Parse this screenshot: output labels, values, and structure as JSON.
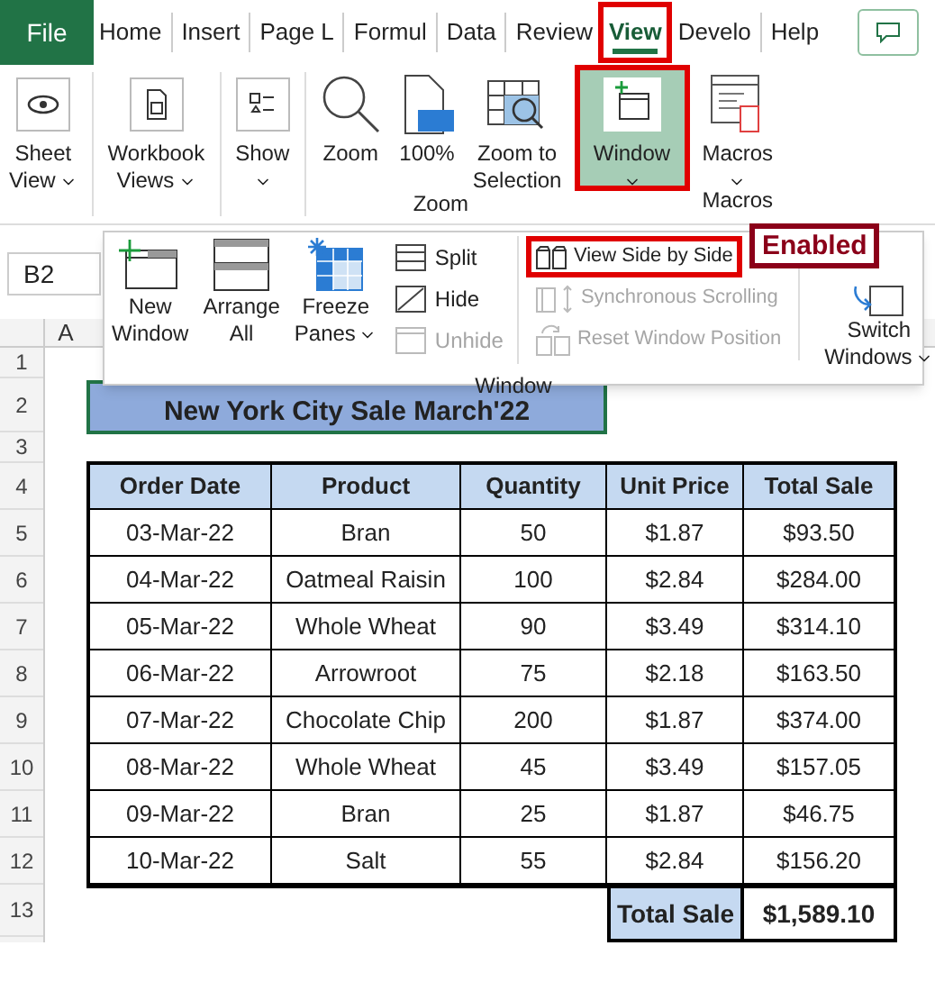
{
  "tabs": [
    {
      "label": "File",
      "kind": "file",
      "selected": false,
      "highlighted": false
    },
    {
      "label": "Home",
      "kind": "tab",
      "selected": false,
      "highlighted": false
    },
    {
      "label": "Insert",
      "kind": "tab",
      "selected": false,
      "highlighted": false
    },
    {
      "label": "Page L",
      "kind": "tab",
      "selected": false,
      "highlighted": false
    },
    {
      "label": "Formul",
      "kind": "tab",
      "selected": false,
      "highlighted": false
    },
    {
      "label": "Data",
      "kind": "tab",
      "selected": false,
      "highlighted": false
    },
    {
      "label": "Review",
      "kind": "tab",
      "selected": false,
      "highlighted": false
    },
    {
      "label": "View",
      "kind": "tab",
      "selected": true,
      "highlighted": true
    },
    {
      "label": "Develo",
      "kind": "tab",
      "selected": false,
      "highlighted": false
    },
    {
      "label": "Help",
      "kind": "tab",
      "selected": false,
      "highlighted": false
    }
  ],
  "ribbon": {
    "groups": [
      {
        "items": [
          {
            "lines": [
              "Sheet",
              "View"
            ],
            "dropdown": true,
            "selected": false,
            "highlighted": false
          }
        ]
      },
      {
        "items": [
          {
            "lines": [
              "Workbook",
              "Views"
            ],
            "dropdown": true,
            "selected": false,
            "highlighted": false
          }
        ]
      },
      {
        "items": [
          {
            "lines": [
              "Show"
            ],
            "dropdown": true,
            "selected": false,
            "highlighted": false
          }
        ]
      },
      {
        "label": "Zoom",
        "items": [
          {
            "lines": [
              "Zoom"
            ],
            "dropdown": false,
            "selected": false,
            "highlighted": false
          },
          {
            "lines": [
              "100%"
            ],
            "dropdown": false,
            "selected": false,
            "highlighted": false
          },
          {
            "lines": [
              "Zoom to",
              "Selection"
            ],
            "dropdown": false,
            "selected": false,
            "highlighted": false
          }
        ]
      },
      {
        "items": [
          {
            "lines": [
              "Window"
            ],
            "dropdown": true,
            "selected": true,
            "highlighted": true
          }
        ]
      },
      {
        "label": "Macros",
        "items": [
          {
            "lines": [
              "Macros"
            ],
            "dropdown": true,
            "selected": false,
            "highlighted": false
          }
        ]
      }
    ]
  },
  "window_menu": {
    "big": [
      {
        "lines": [
          "New",
          "Window"
        ],
        "dropdown": false
      },
      {
        "lines": [
          "Arrange",
          "All"
        ],
        "dropdown": false
      },
      {
        "lines": [
          "Freeze",
          "Panes"
        ],
        "dropdown": true
      }
    ],
    "small_1": [
      {
        "label": "Split",
        "disabled": false,
        "highlighted": false
      },
      {
        "label": "Hide",
        "disabled": false,
        "highlighted": false
      },
      {
        "label": "Unhide",
        "disabled": true,
        "highlighted": false
      }
    ],
    "small_2": [
      {
        "label": "View Side by Side",
        "disabled": false,
        "highlighted": true
      },
      {
        "label": "Synchronous Scrolling",
        "disabled": true,
        "highlighted": false
      },
      {
        "label": "Reset Window Position",
        "disabled": true,
        "highlighted": false
      }
    ],
    "switch": {
      "lines": [
        "Switch",
        "Windows"
      ],
      "dropdown": true
    },
    "label": "Window",
    "callout": "Enabled"
  },
  "sheet": {
    "name_box": "B2",
    "column_header": "A",
    "row_numbers": [
      "1",
      "2",
      "3",
      "4",
      "5",
      "6",
      "7",
      "8",
      "9",
      "10",
      "11",
      "12",
      "13"
    ],
    "title": "New York City Sale March'22",
    "columns": [
      "Order Date",
      "Product",
      "Quantity",
      "Unit Price",
      "Total Sale"
    ],
    "rows": [
      [
        "03-Mar-22",
        "Bran",
        "50",
        "$1.87",
        "$93.50"
      ],
      [
        "04-Mar-22",
        "Oatmeal Raisin",
        "100",
        "$2.84",
        "$284.00"
      ],
      [
        "05-Mar-22",
        "Whole Wheat",
        "90",
        "$3.49",
        "$314.10"
      ],
      [
        "06-Mar-22",
        "Arrowroot",
        "75",
        "$2.18",
        "$163.50"
      ],
      [
        "07-Mar-22",
        "Chocolate Chip",
        "200",
        "$1.87",
        "$374.00"
      ],
      [
        "08-Mar-22",
        "Whole Wheat",
        "45",
        "$3.49",
        "$157.05"
      ],
      [
        "09-Mar-22",
        "Bran",
        "25",
        "$1.87",
        "$46.75"
      ],
      [
        "10-Mar-22",
        "Salt",
        "55",
        "$2.84",
        "$156.20"
      ]
    ],
    "total": {
      "label": "Total Sale",
      "value": "$1,589.10"
    }
  }
}
